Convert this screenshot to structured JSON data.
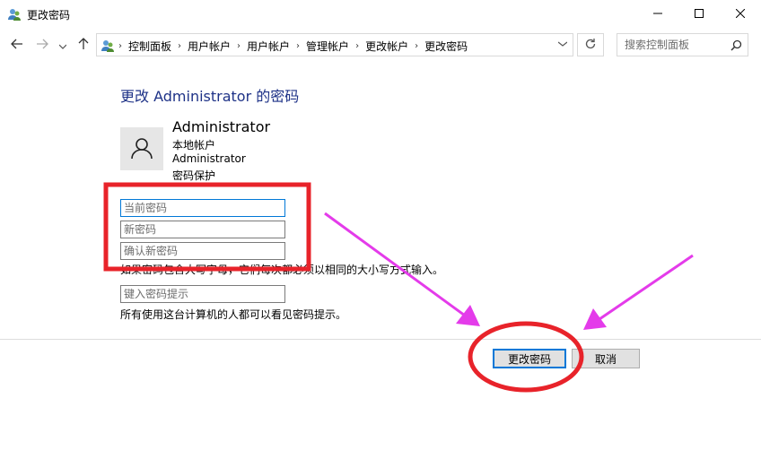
{
  "window": {
    "title": "更改密码",
    "controls": {
      "minimize_icon": "minimize-icon",
      "maximize_icon": "maximize-icon",
      "close_icon": "close-icon"
    }
  },
  "navigation": {
    "back_icon": "arrow-left-icon",
    "forward_icon": "arrow-right-icon",
    "recent_icon": "chevron-down-icon",
    "up_icon": "arrow-up-icon"
  },
  "address_bar": {
    "breadcrumbs": [
      "控制面板",
      "用户帐户",
      "用户帐户",
      "管理帐户",
      "更改帐户",
      "更改密码"
    ],
    "refresh_icon": "refresh-icon"
  },
  "search": {
    "placeholder": "搜索控制面板",
    "icon": "search-icon"
  },
  "main": {
    "heading": "更改 Administrator 的密码",
    "account": {
      "name": "Administrator",
      "type": "本地帐户",
      "group": "Administrator",
      "status": "密码保护"
    },
    "fields": {
      "current_password_placeholder": "当前密码",
      "new_password_placeholder": "新密码",
      "confirm_password_placeholder": "确认新密码",
      "hint_placeholder": "键入密码提示"
    },
    "case_note": "如果密码包含大写字母，它们每次都必须以相同的大小写方式输入。",
    "hint_note": "所有使用这台计算机的人都可以看见密码提示。"
  },
  "buttons": {
    "change_password": "更改密码",
    "cancel": "取消"
  },
  "annotation_colors": {
    "box": "#e8232a",
    "arrow": "#e43bea",
    "focus": "#0078d7"
  }
}
